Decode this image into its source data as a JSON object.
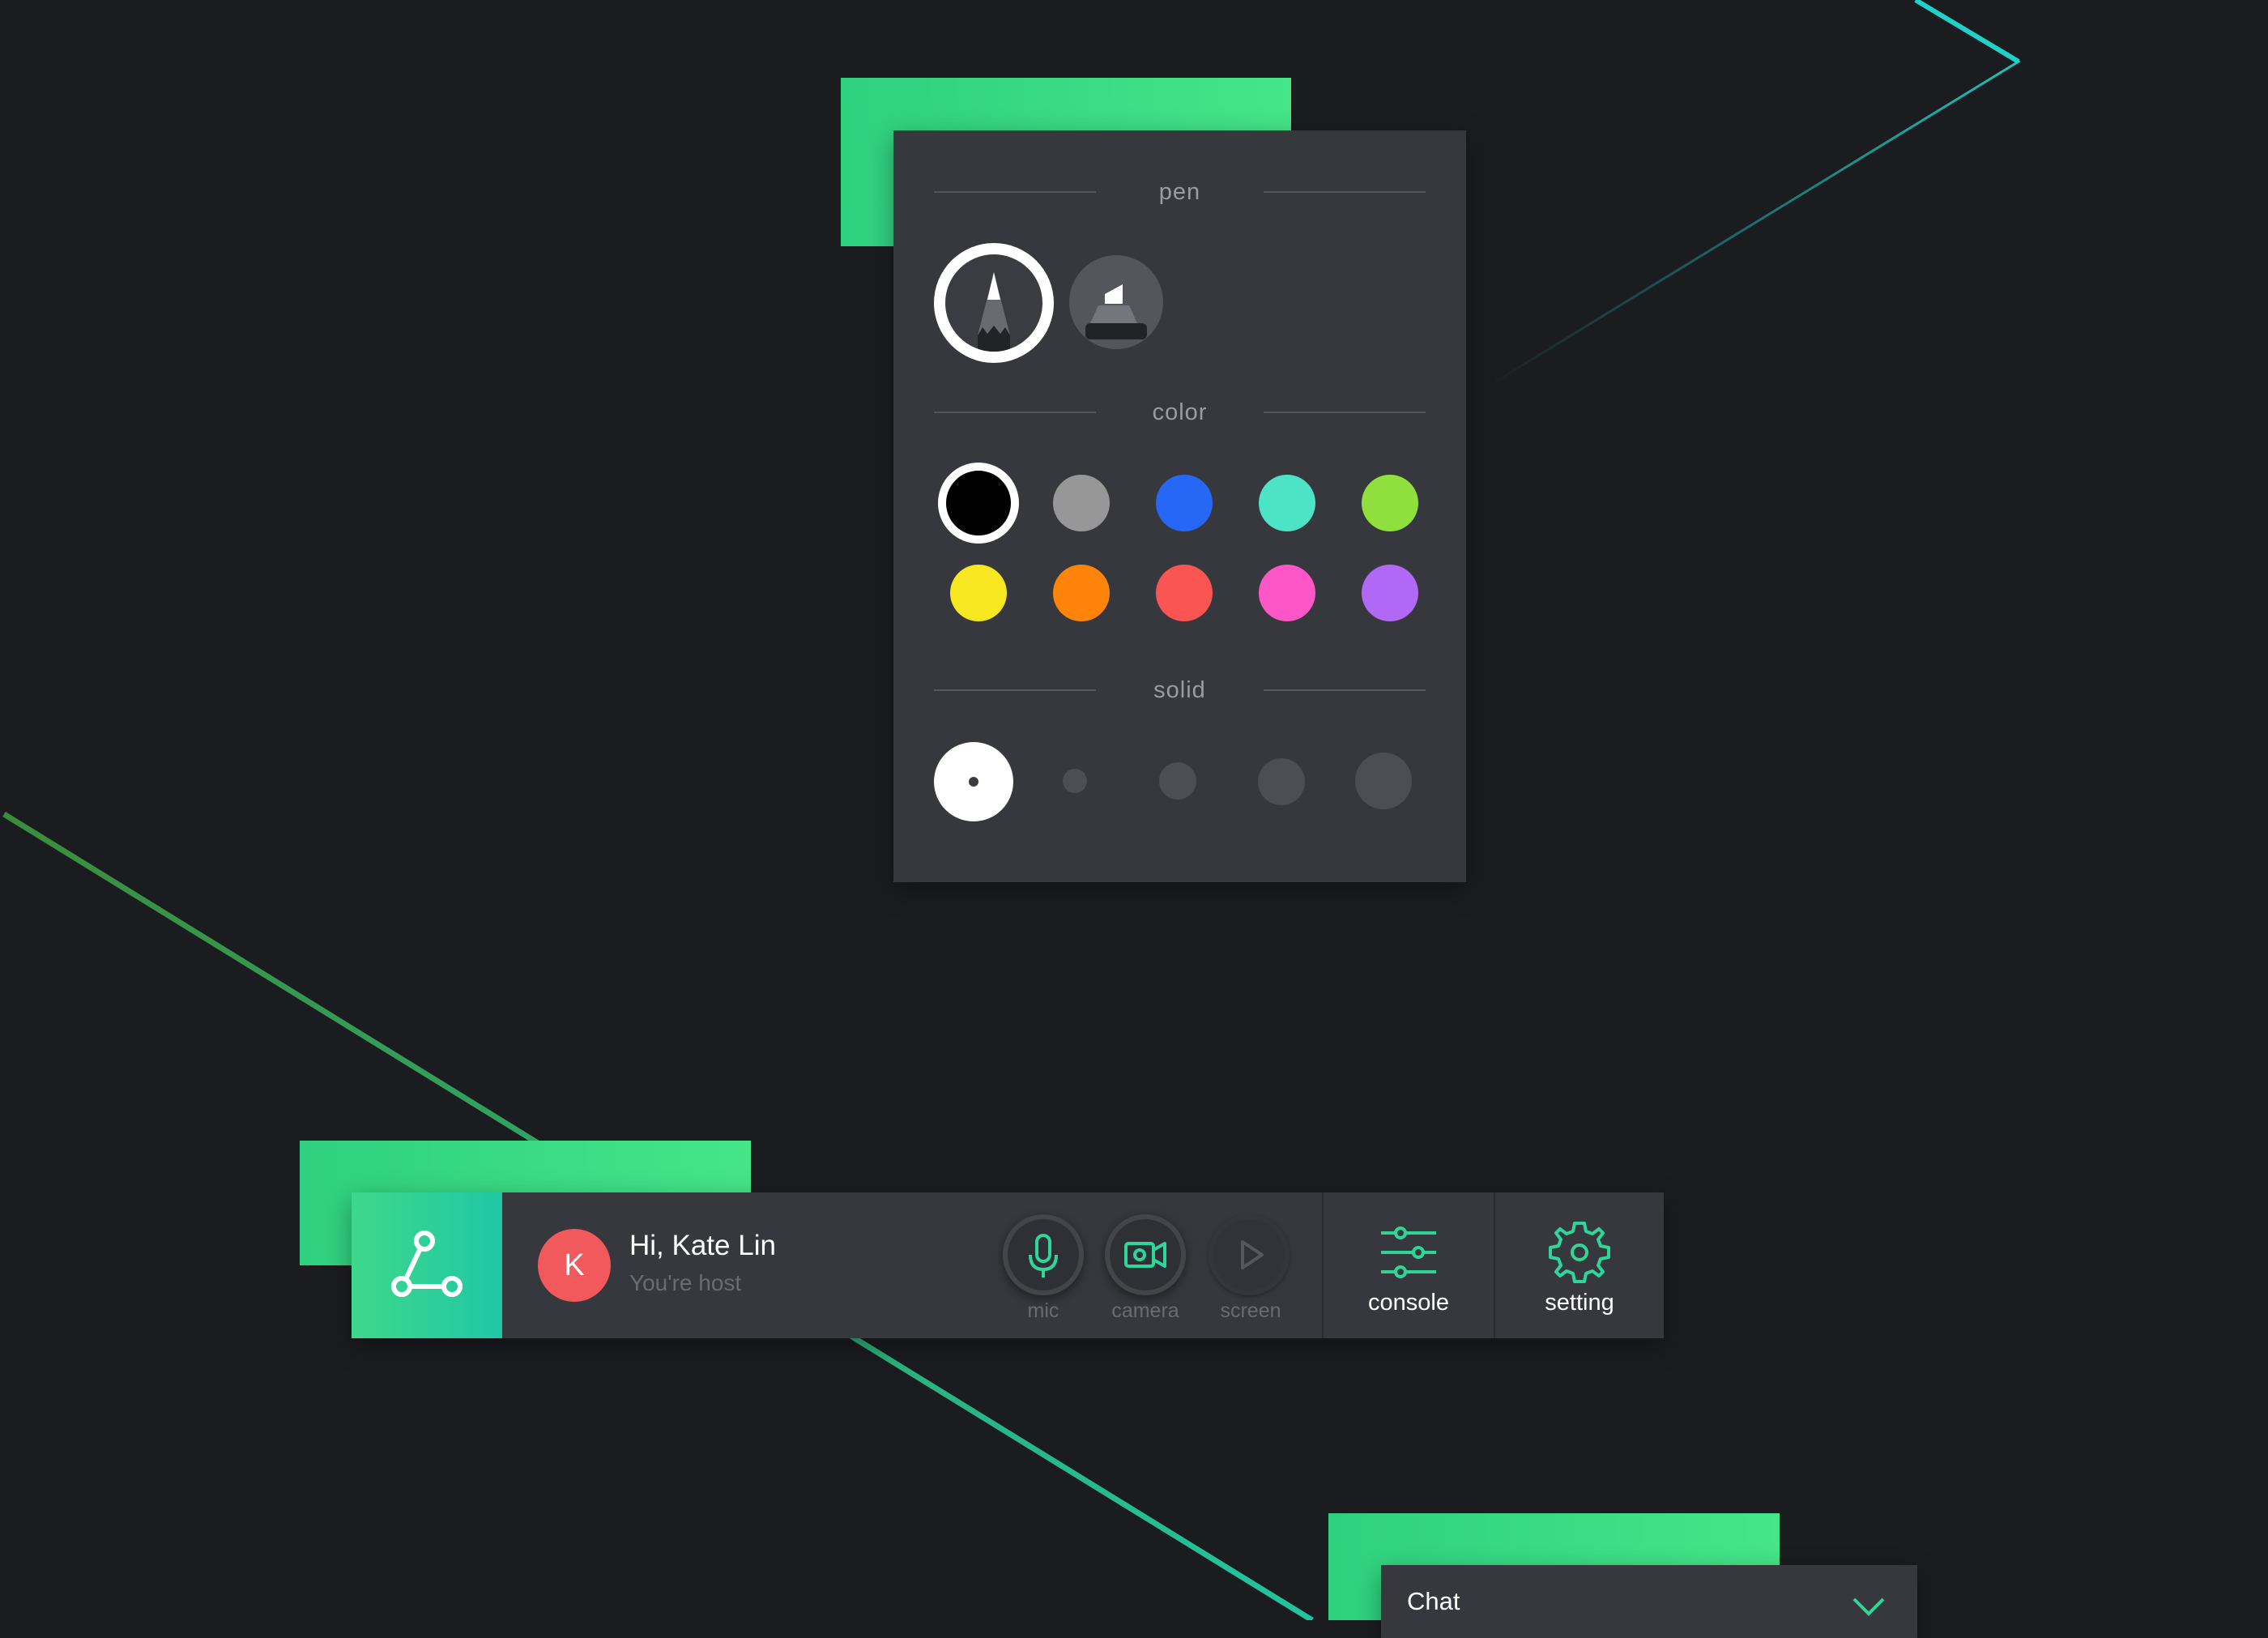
{
  "pen_panel": {
    "pen_heading": "pen",
    "color_heading": "color",
    "stroke_heading": "solid",
    "tools": [
      {
        "name": "pencil",
        "selected": true
      },
      {
        "name": "marker",
        "selected": false
      }
    ],
    "colors": [
      {
        "hex": "#000000",
        "selected": true
      },
      {
        "hex": "#979797",
        "selected": false
      },
      {
        "hex": "#2767f5",
        "selected": false
      },
      {
        "hex": "#4de3c5",
        "selected": false
      },
      {
        "hex": "#8fe03c",
        "selected": false
      },
      {
        "hex": "#f6e720",
        "selected": false
      },
      {
        "hex": "#ff8409",
        "selected": false
      },
      {
        "hex": "#fb5553",
        "selected": false
      },
      {
        "hex": "#fd56c6",
        "selected": false
      },
      {
        "hex": "#b168f5",
        "selected": false
      }
    ],
    "stroke_sizes_count": 5,
    "selected_stroke_size": 1
  },
  "toolbar": {
    "avatar_initial": "K",
    "greeting": "Hi, Kate Lin",
    "role": "You're host",
    "mic_label": "mic",
    "camera_label": "camera",
    "screen_label": "screen",
    "console_label": "console",
    "setting_label": "setting"
  },
  "chat": {
    "title": "Chat"
  },
  "colors": {
    "accent_green": "#3ddc84",
    "accent_teal": "#27c8a4",
    "panel_bg": "#37383e",
    "page_bg": "#1b1c20",
    "avatar_red": "#f1595c"
  }
}
